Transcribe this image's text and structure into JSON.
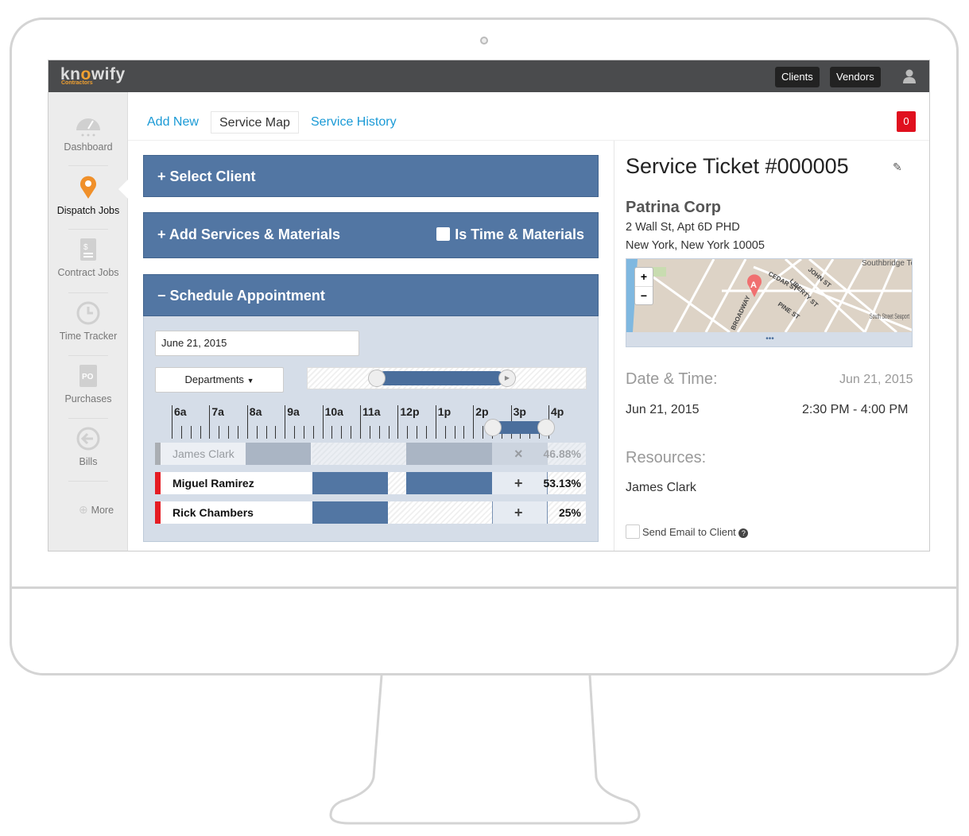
{
  "header": {
    "logo": "knowify",
    "logo_sub": "Contractors",
    "buttons": [
      "Clients",
      "Vendors"
    ],
    "user_icon": "user-icon"
  },
  "sidebar": {
    "items": [
      {
        "label": "Dashboard",
        "icon": "gauge-icon"
      },
      {
        "label": "Dispatch Jobs",
        "icon": "map-pin-icon"
      },
      {
        "label": "Contract Jobs",
        "icon": "document-dollar-icon"
      },
      {
        "label": "Time Tracker",
        "icon": "clock-icon"
      },
      {
        "label": "Purchases",
        "icon": "po-icon"
      },
      {
        "label": "Bills",
        "icon": "arrow-left-circle-icon"
      },
      {
        "label": "More",
        "icon": "plus-circle-icon"
      }
    ]
  },
  "tabs": [
    "Add New",
    "Service Map",
    "Service History"
  ],
  "notification_count": "0",
  "panels": {
    "select_client": "Select Client",
    "add_services": "Add Services & Materials",
    "time_materials": "Is Time & Materials",
    "schedule": "Schedule Appointment"
  },
  "schedule": {
    "date": "June 21, 2015",
    "departments": "Departments",
    "hours": [
      "6a",
      "7a",
      "8a",
      "9a",
      "10a",
      "11a",
      "12p",
      "1p",
      "2p",
      "3p",
      "4p"
    ],
    "resources": [
      {
        "name": "James Clark",
        "percent": "46.88%",
        "action": "×",
        "disabled": true
      },
      {
        "name": "Miguel Ramirez",
        "percent": "53.13%",
        "action": "+"
      },
      {
        "name": "Rick Chambers",
        "percent": "25%",
        "action": "+"
      }
    ]
  },
  "ticket": {
    "title": "Service Ticket #000005",
    "client": "Patrina Corp",
    "address1": "2 Wall St, Apt 6D PHD",
    "address2": "New York, New York 10005",
    "map": {
      "zoom_in": "+",
      "zoom_out": "−",
      "marker": "A",
      "labels": [
        "Southbridge Towers",
        "CEDAR ST",
        "JOHN ST",
        "LIBERTY ST",
        "PINE ST",
        "BROADWAY",
        "South Street Seaport"
      ],
      "more": "•••"
    },
    "datetime_label": "Date & Time:",
    "datetime_short": "Jun 21, 2015",
    "date": "Jun 21, 2015",
    "time": "2:30 PM - 4:00 PM",
    "resources_label": "Resources:",
    "resource": "James Clark",
    "send_email": "Send Email to Client"
  },
  "colors": {
    "header": "#4a4b4d",
    "panel": "#5276a3",
    "accent": "#1a9ad6",
    "badge": "#e0101e",
    "pin": "#f0902a"
  }
}
